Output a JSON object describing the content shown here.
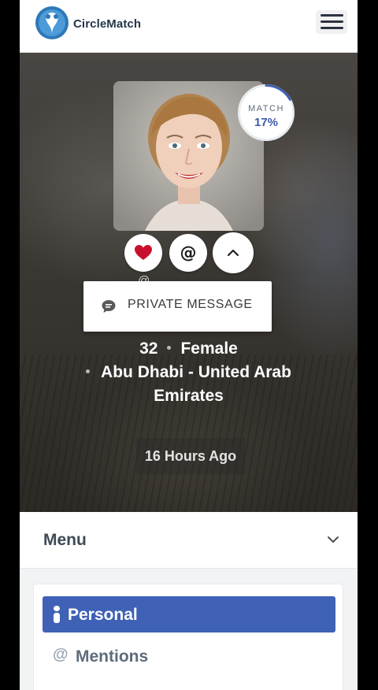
{
  "app": {
    "brand": "CircleMatch"
  },
  "header": {
    "menu_icon": "hamburger-icon"
  },
  "profile": {
    "match_label": "MATCH",
    "match_percent_text": "17%",
    "match_fraction": 0.17,
    "username_partial": "@ .. . .. .. .",
    "actions": {
      "like_icon": "heart-icon",
      "mention_icon": "at-icon",
      "collapse_icon": "chevron-up-icon"
    },
    "private_message_label": "PRIVATE MESSAGE",
    "age": "32",
    "gender": "Female",
    "location_line1": "Abu Dhabi - United Arab",
    "location_line2": "Emirates",
    "last_seen": "16 Hours Ago"
  },
  "menu": {
    "title": "Menu",
    "toggle_icon": "chevron-down-icon",
    "items": [
      {
        "label": "Personal",
        "icon": "person-icon",
        "active": true
      },
      {
        "label": "Mentions",
        "icon": "at-icon",
        "active": false
      }
    ]
  },
  "colors": {
    "accent": "#3f61b6",
    "brand_text": "#24364a",
    "like": "#c8102e"
  }
}
